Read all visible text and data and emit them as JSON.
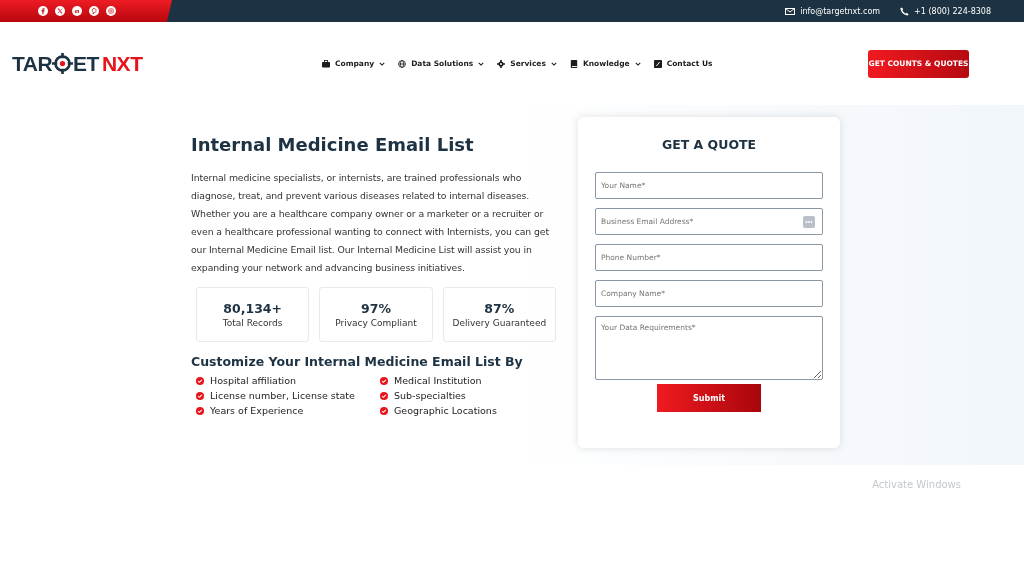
{
  "top_bar": {
    "email": "info@targetnxt.com",
    "phone": "+1 (800) 224-8308"
  },
  "logo": {
    "part_1": "TAR",
    "part_2": "ET",
    "accent": "NXT"
  },
  "nav": [
    {
      "label": "Company",
      "dropdown": true
    },
    {
      "label": "Data Solutions",
      "dropdown": true
    },
    {
      "label": "Services",
      "dropdown": true
    },
    {
      "label": "Knowledge",
      "dropdown": true
    },
    {
      "label": "Contact Us",
      "dropdown": false
    }
  ],
  "cta": "GET COUNTS & QUOTES",
  "hero": {
    "title": "Internal Medicine Email List",
    "description": "Internal medicine specialists, or internists, are trained professionals who diagnose, treat, and prevent various diseases related to internal diseases. Whether you are a healthcare company owner or a marketer or a recruiter or even a healthcare professional wanting to connect with Internists, you can get our Internal Medicine Email list. Our Internal Medicine List will assist you in expanding your network and advancing business initiatives.",
    "stats": [
      {
        "value": "80,134+",
        "label": "Total Records"
      },
      {
        "value": "97%",
        "label": "Privacy Compliant"
      },
      {
        "value": "87%",
        "label": "Delivery Guaranteed"
      }
    ],
    "customize_title": "Customize Your Internal Medicine Email List By",
    "features": [
      "Hospital affiliation",
      "Medical Institution",
      "License number, License state",
      "Sub-specialties",
      "Years of Experience",
      "Geographic Locations"
    ]
  },
  "quote_form": {
    "title": "GET A QUOTE",
    "fields": [
      {
        "placeholder": "Your Name*",
        "kind": "input"
      },
      {
        "placeholder": "Business Email Address*",
        "kind": "input-with-icon"
      },
      {
        "placeholder": "Phone Number*",
        "kind": "input"
      },
      {
        "placeholder": "Company Name*",
        "kind": "input"
      },
      {
        "placeholder": "Your Data Requirements*",
        "kind": "textarea"
      }
    ],
    "submit": "Submit"
  },
  "os_notice": "Activate Windows"
}
